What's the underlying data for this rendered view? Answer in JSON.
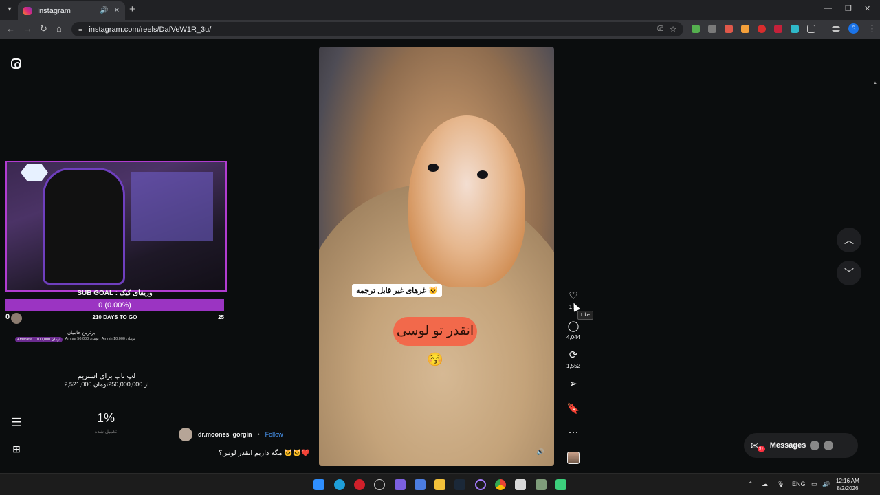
{
  "browser": {
    "tab_title": "Instagram",
    "url": "instagram.com/reels/DafVeW1R_3u/",
    "profile_initial": "S"
  },
  "icons": {
    "tab_list": "chevron-down-icon",
    "audio": "speaker-icon",
    "close": "close-icon",
    "new_tab": "plus-icon",
    "back": "arrow-left-icon",
    "forward": "arrow-right-icon",
    "reload": "reload-icon",
    "home": "home-icon",
    "site_info": "tune-icon",
    "install": "install-icon",
    "bookmark": "star-icon",
    "instagram": "instagram-icon",
    "menu": "hamburger-icon",
    "more": "grid-icon",
    "like": "heart-icon",
    "comment": "comment-icon",
    "repost": "repost-icon",
    "share": "send-icon",
    "save": "bookmark-icon",
    "options": "more-icon",
    "mute": "speaker-icon",
    "up": "chevron-up-icon",
    "down": "chevron-down-icon",
    "messages": "messenger-icon"
  },
  "stream": {
    "sub_goal": "SUB GOAL : وریفای کیک",
    "progress": "0 (0.00%)",
    "progress_left": "0",
    "days_to_go": "210 DAYS TO GO",
    "progress_right": "25",
    "top_supporters": "برترین حامیان",
    "donors": [
      "Ameratia... 100,000 تومان",
      "Amraa 50,000 تومان",
      "Amrsh 10,000 تومان"
    ],
    "laptop_title": "لپ تاپ برای استریم",
    "laptop_sub": "2,521,000 از 250,000,000تومان",
    "percent": "1%",
    "percent_label": "تکمیل شده"
  },
  "reel": {
    "caption_chip": "غرهای غیر قابل ترجمه 😺",
    "caption_pill": "انقدر تو لوسی 😚",
    "author": "dr.moones_gorgin",
    "separator": "•",
    "follow": "Follow",
    "post_caption": "مگه داریم انقدر لوس؟ 🐱🐱❤️",
    "like_count": "1…",
    "comment_count": "4,044",
    "repost_count": "1,552",
    "tooltip": "Like"
  },
  "messages": {
    "label": "Messages",
    "badge": "9+"
  },
  "taskbar": {
    "lang": "ENG",
    "time": "12:16 AM",
    "date": "8/2/2026"
  },
  "colors": {
    "accent": "#9b34c2",
    "follow": "#4d9eff",
    "caption_pill": "#f2694b",
    "notification": "#ff3040"
  }
}
